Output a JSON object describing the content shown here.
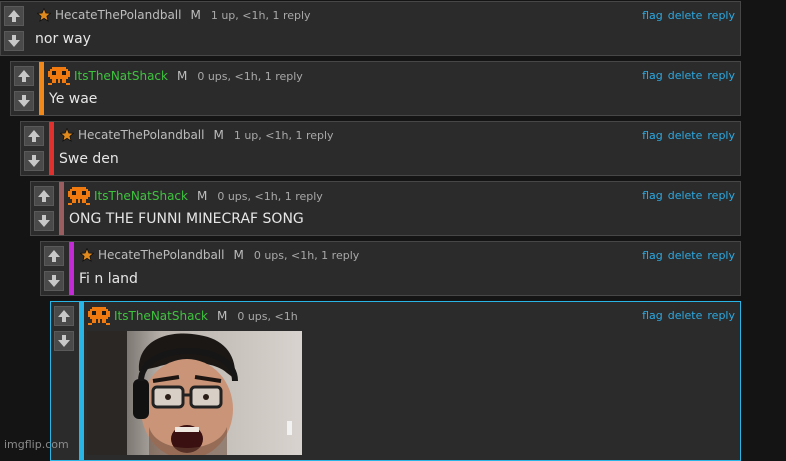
{
  "comments": [
    {
      "user": "HecateThePolandball",
      "mod": "M",
      "meta": "1 up, <1h, 1 reply",
      "text": "nor way",
      "bar": ""
    },
    {
      "user": "ItsTheNatShack",
      "mod": "M",
      "meta": "0 ups, <1h, 1 reply",
      "text": "Ye wae",
      "bar": "#f0881a"
    },
    {
      "user": "HecateThePolandball",
      "mod": "M",
      "meta": "1 up, <1h, 1 reply",
      "text": "Swe den",
      "bar": "#e0312f"
    },
    {
      "user": "ItsTheNatShack",
      "mod": "M",
      "meta": "0 ups, <1h, 1 reply",
      "text": "ONG THE FUNNI MINECRAF SONG",
      "bar": "#9a5e60"
    },
    {
      "user": "HecateThePolandball",
      "mod": "M",
      "meta": "0 ups, <1h, 1 reply",
      "text": "Fi n land",
      "bar": "#c22bd6"
    },
    {
      "user": "ItsTheNatShack",
      "mod": "M",
      "meta": "0 ups, <1h",
      "text": "",
      "bar": "#29b6e6"
    }
  ],
  "actions": {
    "flag": "flag",
    "delete": "delete",
    "reply": "reply"
  },
  "watermark": "imgflip.com",
  "colors": {
    "link": "#2ca9e1",
    "nat_user": "#3fc33f",
    "background": "#141414"
  }
}
